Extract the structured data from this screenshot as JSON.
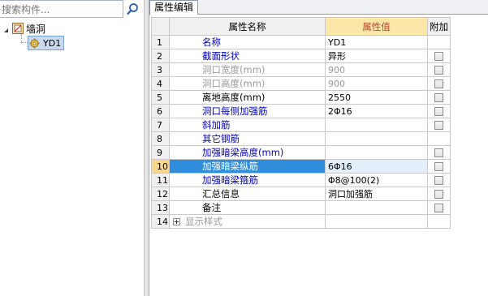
{
  "left_panel": {
    "search": {
      "placeholder": "搜索构件..."
    },
    "tree": {
      "root": {
        "label": "墙洞",
        "icon": "wall-opening-icon"
      },
      "child": {
        "label": "YD1",
        "icon": "component-gear-icon"
      }
    }
  },
  "right_panel": {
    "tab": {
      "label": "属性编辑"
    },
    "columns": {
      "name": "属性名称",
      "value": "属性值",
      "extra": "附加"
    },
    "rows": [
      {
        "num": "1",
        "name": "名称",
        "value": "YD1",
        "checkbox": false,
        "style": "blue"
      },
      {
        "num": "2",
        "name": "截面形状",
        "value": "异形",
        "checkbox": true,
        "style": "blue"
      },
      {
        "num": "3",
        "name": "洞口宽度(mm)",
        "value": "900",
        "checkbox": true,
        "style": "gray"
      },
      {
        "num": "4",
        "name": "洞口高度(mm)",
        "value": "900",
        "checkbox": true,
        "style": "gray"
      },
      {
        "num": "5",
        "name": "离地高度(mm)",
        "value": "2550",
        "checkbox": true,
        "style": "black"
      },
      {
        "num": "6",
        "name": "洞口每侧加强筋",
        "value": "2Φ16",
        "checkbox": true,
        "style": "blue"
      },
      {
        "num": "7",
        "name": "斜加筋",
        "value": "",
        "checkbox": true,
        "style": "blue"
      },
      {
        "num": "8",
        "name": "其它钢筋",
        "value": "",
        "checkbox": false,
        "style": "blue"
      },
      {
        "num": "9",
        "name": "加强暗梁高度(mm)",
        "value": "",
        "checkbox": true,
        "style": "blue"
      },
      {
        "num": "10",
        "name": "加强暗梁纵筋",
        "value": "6Φ16",
        "checkbox": true,
        "style": "blue",
        "selected": true
      },
      {
        "num": "11",
        "name": "加强暗梁箍筋",
        "value": "Φ8@100(2)",
        "checkbox": true,
        "style": "blue"
      },
      {
        "num": "12",
        "name": "汇总信息",
        "value": "洞口加强筋",
        "checkbox": true,
        "style": "black"
      },
      {
        "num": "13",
        "name": "备注",
        "value": "",
        "checkbox": true,
        "style": "black"
      },
      {
        "num": "14",
        "name": "显示样式",
        "value": "",
        "checkbox": false,
        "style": "gray",
        "expandable": true
      }
    ]
  }
}
